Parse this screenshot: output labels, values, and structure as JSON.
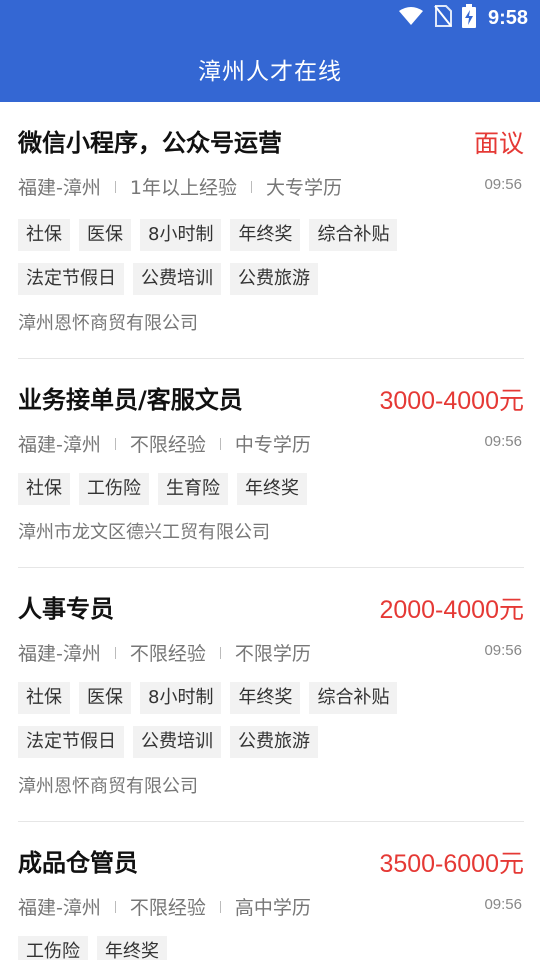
{
  "status_bar": {
    "time": "9:58"
  },
  "app_bar": {
    "title": "漳州人才在线"
  },
  "colors": {
    "primary": "#3467d3",
    "salary": "#e53935"
  },
  "jobs": [
    {
      "title": "微信小程序，公众号运营",
      "salary": "面议",
      "location": "福建-漳州",
      "experience": "1年以上经验",
      "education": "大专学历",
      "time": "09:56",
      "tags": [
        "社保",
        "医保",
        "8小时制",
        "年终奖",
        "综合补贴",
        "法定节假日",
        "公费培训",
        "公费旅游"
      ],
      "company": "漳州恩怀商贸有限公司"
    },
    {
      "title": "业务接单员/客服文员",
      "salary": "3000-4000元",
      "location": "福建-漳州",
      "experience": "不限经验",
      "education": "中专学历",
      "time": "09:56",
      "tags": [
        "社保",
        "工伤险",
        "生育险",
        "年终奖"
      ],
      "company": "漳州市龙文区德兴工贸有限公司"
    },
    {
      "title": "人事专员",
      "salary": "2000-4000元",
      "location": "福建-漳州",
      "experience": "不限经验",
      "education": "不限学历",
      "time": "09:56",
      "tags": [
        "社保",
        "医保",
        "8小时制",
        "年终奖",
        "综合补贴",
        "法定节假日",
        "公费培训",
        "公费旅游"
      ],
      "company": "漳州恩怀商贸有限公司"
    },
    {
      "title": "成品仓管员",
      "salary": "3500-6000元",
      "location": "福建-漳州",
      "experience": "不限经验",
      "education": "高中学历",
      "time": "09:56",
      "tags": [
        "工伤险",
        "年终奖"
      ],
      "company": ""
    }
  ]
}
